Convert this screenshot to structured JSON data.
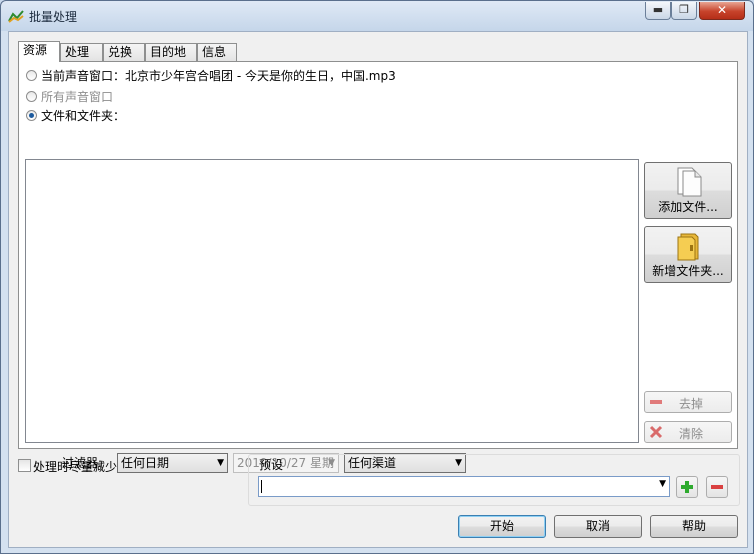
{
  "window": {
    "title": "批量处理",
    "close_glyph": "✕",
    "min_glyph": "▬",
    "max_glyph": "❐"
  },
  "tabs": [
    {
      "label": "资源",
      "active": true
    },
    {
      "label": "处理",
      "active": false
    },
    {
      "label": "兑换",
      "active": false
    },
    {
      "label": "目的地",
      "active": false
    },
    {
      "label": "信息",
      "active": false
    }
  ],
  "source": {
    "current_window_label": "当前声音窗口：北京市少年宫合唱团 - 今天是你的生日，中国.mp3",
    "all_windows_label": "所有声音窗口",
    "files_folders_label": "文件和文件夹：",
    "selected": "files_folders"
  },
  "buttons": {
    "add_file": "添加文件...",
    "new_folder": "新增文件夹...",
    "remove": "去掉",
    "clear": "清除",
    "start": "开始",
    "cancel": "取消",
    "help": "帮助"
  },
  "filter": {
    "label": "过滤器:",
    "date_option": "任何日期",
    "date_value": "2019/10/27 星期",
    "channel_option": "任何渠道"
  },
  "options": {
    "reduce_label": "处理时尽量减少",
    "reduce_checked": false
  },
  "preset": {
    "title": "预设",
    "value": ""
  },
  "colors": {
    "accent": "#1c5a9e",
    "close_red": "#c7432b",
    "add_green": "#2eaa2e",
    "remove_red": "#d94040"
  },
  "icons": [
    "app-chart-icon",
    "document-icon",
    "folder-icon",
    "minus-icon",
    "x-icon",
    "plus-icon"
  ]
}
